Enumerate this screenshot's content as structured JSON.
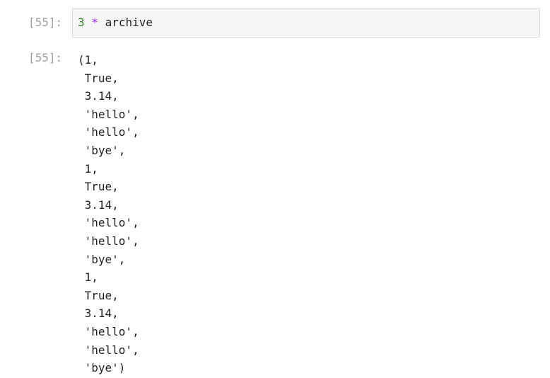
{
  "input_cell": {
    "prompt": "[55]:",
    "code": {
      "number": "3",
      "operator": "*",
      "name": "archive"
    }
  },
  "output_cell": {
    "prompt": "[55]:",
    "lines": [
      "(1,",
      " True,",
      " 3.14,",
      " 'hello',",
      " 'hello',",
      " 'bye',",
      " 1,",
      " True,",
      " 3.14,",
      " 'hello',",
      " 'hello',",
      " 'bye',",
      " 1,",
      " True,",
      " 3.14,",
      " 'hello',",
      " 'hello',",
      " 'bye')"
    ]
  },
  "colors": {
    "number": "#2e8b22",
    "operator": "#aa22ff",
    "prompt": "#9e9e9e",
    "input_bg": "#f6f6f6",
    "input_border": "#dcdcdc"
  }
}
